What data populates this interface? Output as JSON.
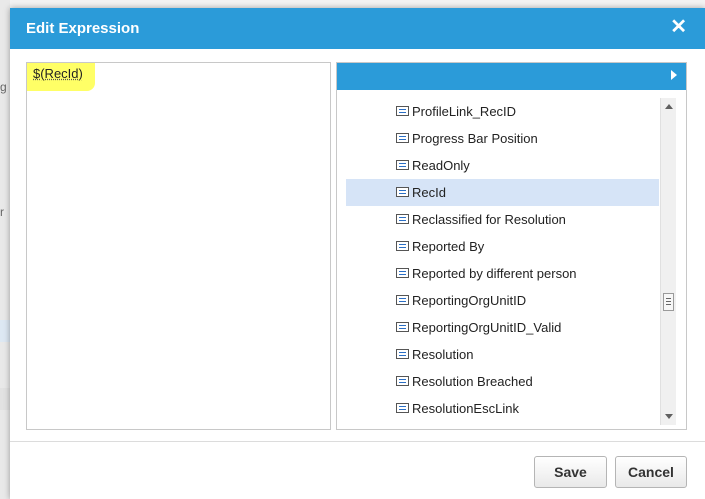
{
  "dialog": {
    "title": "Edit Expression",
    "close_glyph": "✕"
  },
  "expression": {
    "text": "$(RecId)"
  },
  "field_list": {
    "items": [
      {
        "label": "ProfileLink_RecID",
        "selected": false
      },
      {
        "label": "Progress Bar Position",
        "selected": false
      },
      {
        "label": "ReadOnly",
        "selected": false
      },
      {
        "label": "RecId",
        "selected": true
      },
      {
        "label": "Reclassified for Resolution",
        "selected": false
      },
      {
        "label": "Reported By",
        "selected": false
      },
      {
        "label": "Reported by different person",
        "selected": false
      },
      {
        "label": "ReportingOrgUnitID",
        "selected": false
      },
      {
        "label": "ReportingOrgUnitID_Valid",
        "selected": false
      },
      {
        "label": "Resolution",
        "selected": false
      },
      {
        "label": "Resolution Breached",
        "selected": false
      },
      {
        "label": "ResolutionEscLink",
        "selected": false
      }
    ]
  },
  "buttons": {
    "save_label": "Save",
    "cancel_label": "Cancel"
  },
  "background": {
    "glyph_1": "g",
    "glyph_2": "r"
  },
  "colors": {
    "accent": "#2b9bd9",
    "highlight": "#ffff66",
    "selected_row": "#d6e4f7"
  }
}
